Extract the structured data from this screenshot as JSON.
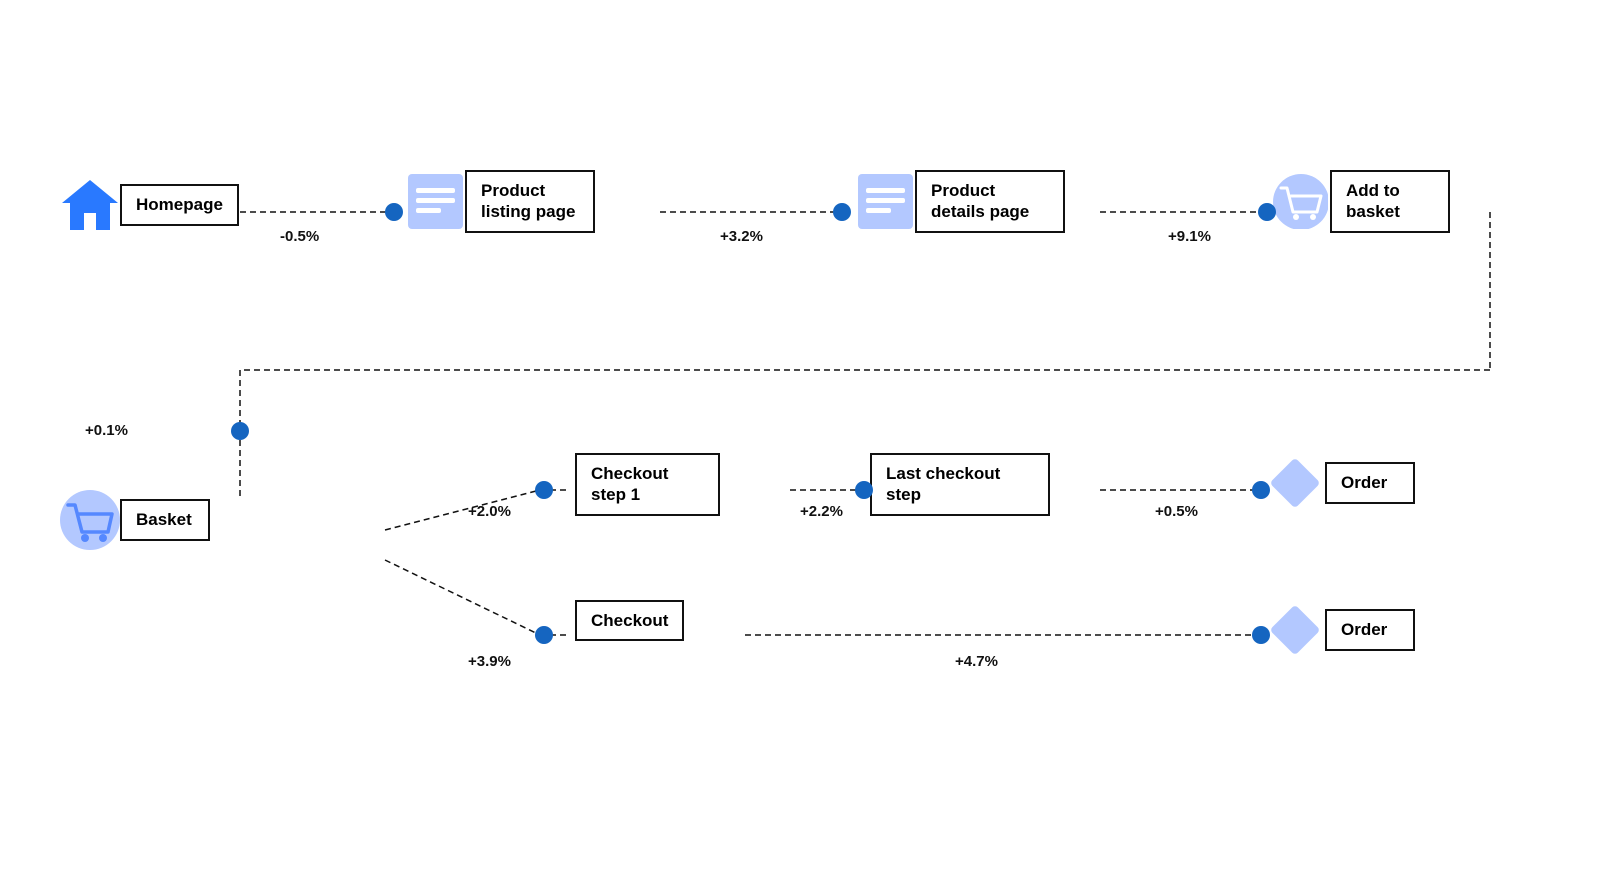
{
  "nodes": {
    "homepage": {
      "label": "Homepage"
    },
    "product_listing": {
      "label": "Product\nlisting page"
    },
    "product_details": {
      "label": "Product\ndetails page"
    },
    "add_to_basket": {
      "label": "Add to\nbasket"
    },
    "basket": {
      "label": "Basket"
    },
    "checkout_step1": {
      "label": "Checkout\nstep 1"
    },
    "last_checkout": {
      "label": "Last checkout\nstep"
    },
    "order1": {
      "label": "Order"
    },
    "checkout": {
      "label": "Checkout"
    },
    "order2": {
      "label": "Order"
    }
  },
  "percentages": {
    "hp_to_plp": "-0.5%",
    "plp_to_pdp": "+3.2%",
    "pdp_to_atb": "+9.1%",
    "basket_back": "+0.1%",
    "basket_to_cs1": "+2.0%",
    "cs1_to_lcs": "+2.2%",
    "lcs_to_order1": "+0.5%",
    "basket_to_checkout": "+3.9%",
    "checkout_to_order2": "+4.7%"
  },
  "colors": {
    "blue_dark": "#1565c0",
    "blue_icon": "#2979ff",
    "blue_light": "#b3c8ff",
    "text": "#111111"
  }
}
